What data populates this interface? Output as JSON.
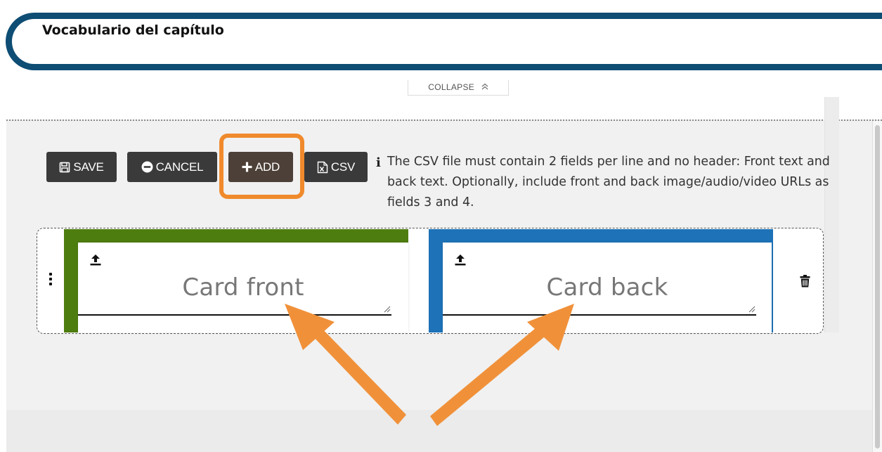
{
  "header": {
    "title": "Vocabulario del capítulo",
    "collapse_label": "COLLAPSE",
    "collapse_icon": "double-chevron-up-icon"
  },
  "toolbar": {
    "save_label": "SAVE",
    "save_icon": "floppy-disk-icon",
    "cancel_label": "CANCEL",
    "cancel_icon": "minus-circle-icon",
    "add_label": "ADD",
    "add_icon": "plus-icon",
    "csv_label": "CSV",
    "csv_icon": "csv-file-icon"
  },
  "info": {
    "icon": "info-icon",
    "text": "The CSV file must contain 2 fields per line and no header: Front text and back text. Optionally, include front and back image/audio/video URLs as fields 3 and 4."
  },
  "cards": {
    "front": {
      "placeholder": "Card front",
      "accent_color": "#4e7d0f",
      "upload_icon": "upload-icon"
    },
    "back": {
      "placeholder": "Card back",
      "accent_color": "#1d72b8",
      "upload_icon": "upload-icon"
    },
    "delete_icon": "trash-icon",
    "drag_icon": "vertical-dots-icon"
  },
  "colors": {
    "header_border": "#0e4d74",
    "button_bg": "#3a3a3a",
    "highlight": "#f08a2c"
  }
}
